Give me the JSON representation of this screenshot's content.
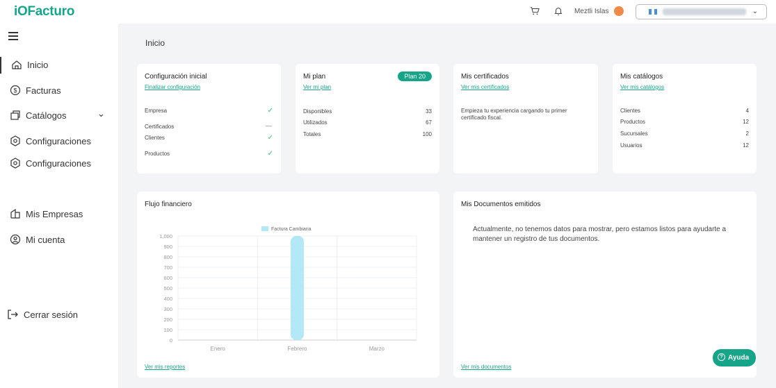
{
  "app": {
    "logo": "iOFacturo"
  },
  "header": {
    "user_name": "Meztli Islas",
    "company_name": "",
    "icons": [
      "cart-icon",
      "bell-icon",
      "chevron-down-icon"
    ]
  },
  "sidebar": {
    "items": [
      {
        "label": "Inicio",
        "icon": "home-icon"
      },
      {
        "label": "Facturas",
        "icon": "dollar-icon"
      },
      {
        "label": "Catálogos",
        "icon": "catalog-icon"
      },
      {
        "label": "Configuraciones",
        "icon": "gear-icon"
      },
      {
        "label": "Configuraciones",
        "icon": "gear-icon"
      },
      {
        "label": "Mis Empresas",
        "icon": "building-icon"
      },
      {
        "label": "Mi cuenta",
        "icon": "user-icon"
      }
    ],
    "logout": "Cerrar sesión"
  },
  "main": {
    "title": "Inicio",
    "config": {
      "title": "Configuración inicial",
      "link": "Finalizar configuración",
      "rows": [
        {
          "label": "Empresa",
          "status": "check"
        },
        {
          "label": "Certificados",
          "status": "dash"
        },
        {
          "label": "Clientes",
          "status": "check"
        },
        {
          "label": "Productos",
          "status": "check"
        }
      ]
    },
    "plan": {
      "title": "Mi plan",
      "link": "Ver mi plan",
      "badge": "Plan 20",
      "rows": [
        {
          "label": "Disponibles",
          "value": "33"
        },
        {
          "label": "Utilizados",
          "value": "67"
        },
        {
          "label": "Totales",
          "value": "100"
        }
      ]
    },
    "certs": {
      "title": "Mis certificados",
      "link": "Ver mis certificados",
      "text": "Empieza tu experiencia cargando tu primer certificado fiscal."
    },
    "catalogs": {
      "title": "Mis catálogos",
      "link": "Ver mis catálogos",
      "rows": [
        {
          "label": "Clientes",
          "value": "4"
        },
        {
          "label": "Productos",
          "value": "12"
        },
        {
          "label": "Sucursales",
          "value": "2"
        },
        {
          "label": "Usuarios",
          "value": "12"
        }
      ]
    },
    "flow": {
      "title": "Flujo financiero",
      "link": "Ver mis reportes"
    },
    "docs": {
      "title": "Mis Documentos emitidos",
      "text": "Actualmente, no tenemos datos para mostrar, pero estamos listos para ayudarte a mantener un registro de tus documentos.",
      "link": "Ver mis documentos"
    },
    "help": "Ayuda"
  },
  "chart_data": {
    "type": "bar",
    "categories": [
      "Enero",
      "Febrero",
      "Marzo"
    ],
    "series": [
      {
        "name": "Factura Cambiaria",
        "values": [
          0,
          1000,
          0
        ]
      }
    ],
    "yticks": [
      "0",
      "100",
      "200",
      "300",
      "400",
      "500",
      "600",
      "700",
      "800",
      "900",
      "1,000"
    ],
    "ylim": [
      0,
      1000
    ],
    "grid": true,
    "legend": "top",
    "color": "#b3e9f7"
  }
}
